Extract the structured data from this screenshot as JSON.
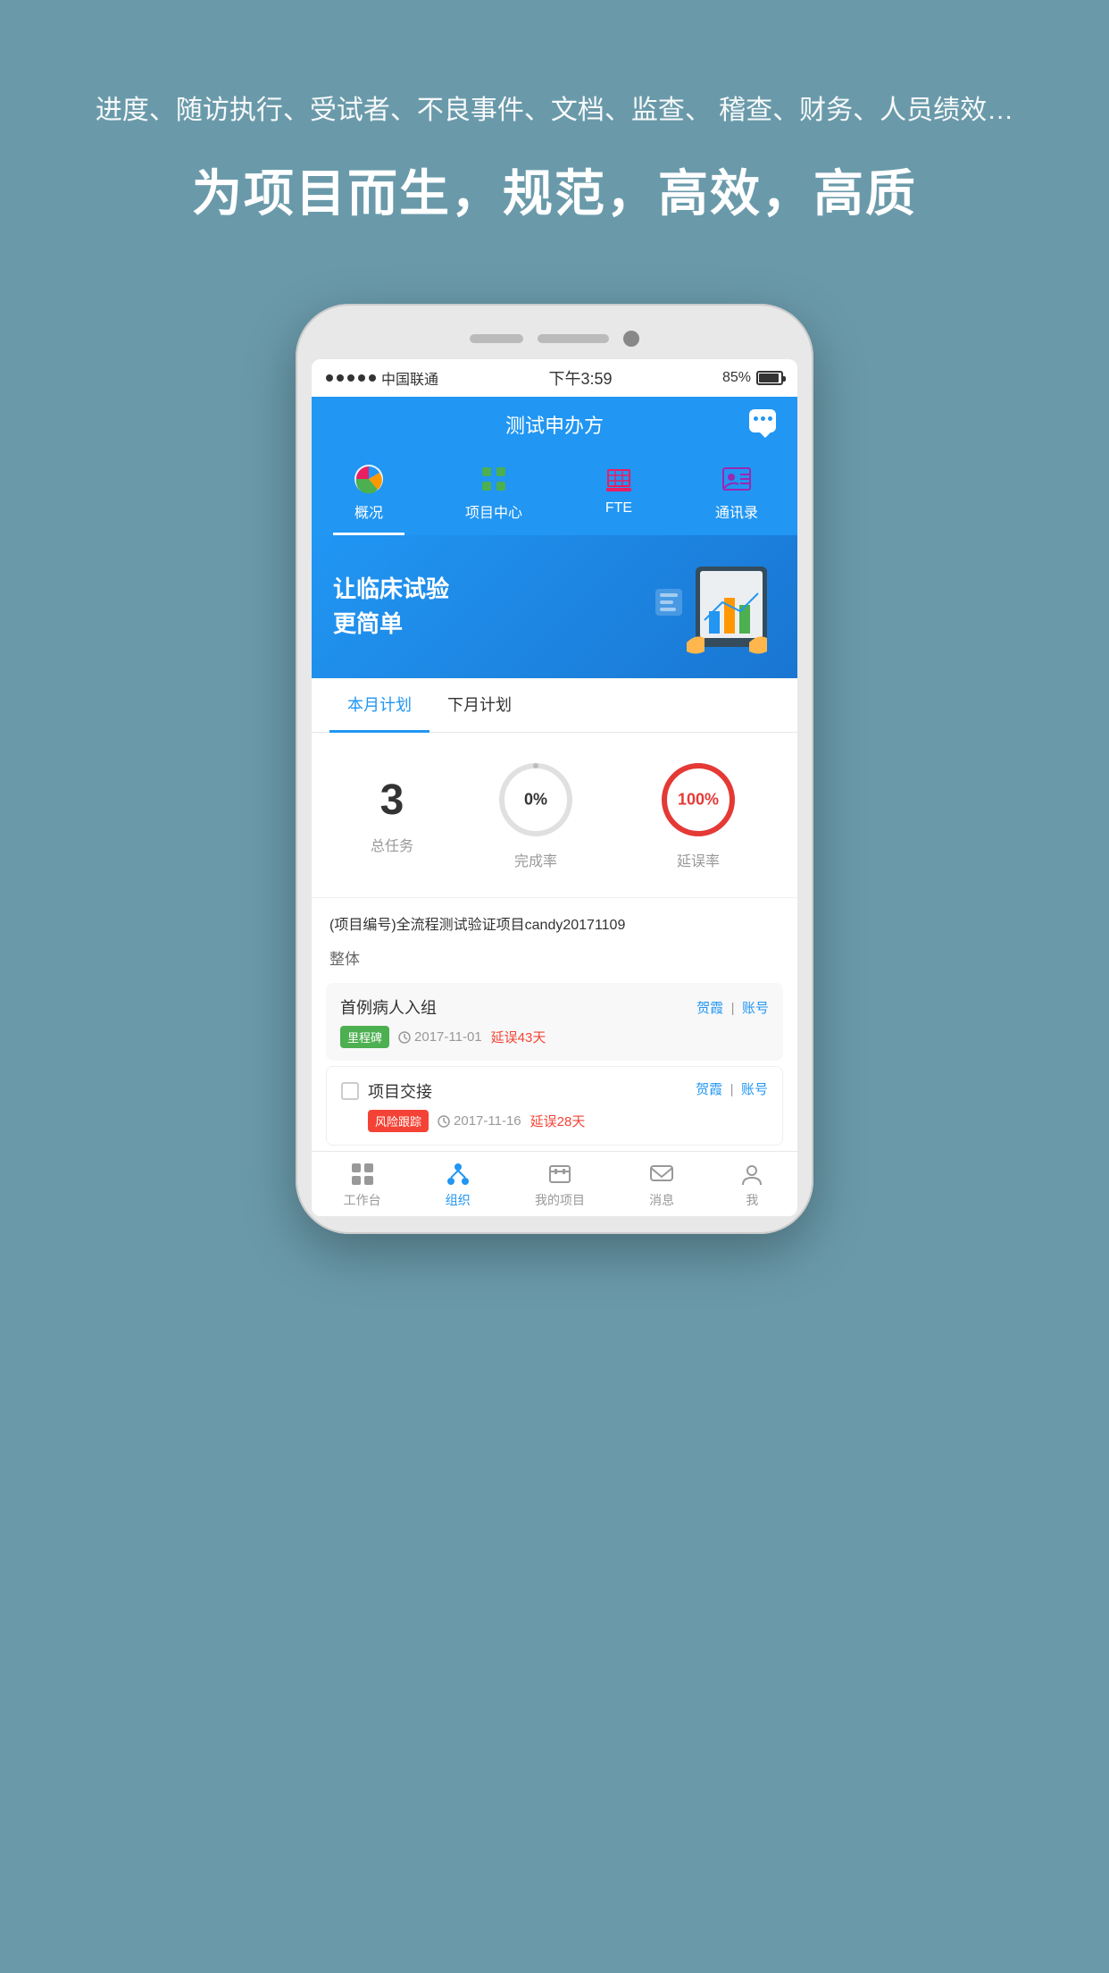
{
  "background": {
    "color": "#6a9aaa"
  },
  "top_section": {
    "subtitle": "进度、随访执行、受试者、不良事件、文档、监查、\n稽查、财务、人员绩效…",
    "title": "为项目而生，规范，高效，高质"
  },
  "phone": {
    "status_bar": {
      "dots": 5,
      "carrier": "中国联通",
      "time": "下午3:59",
      "battery_percent": "85%"
    },
    "app_header": {
      "title": "测试申办方"
    },
    "nav_tabs": [
      {
        "id": "overview",
        "label": "概况",
        "active": true
      },
      {
        "id": "projects",
        "label": "项目中心",
        "active": false
      },
      {
        "id": "fte",
        "label": "FTE",
        "active": false
      },
      {
        "id": "contacts",
        "label": "通讯录",
        "active": false
      }
    ],
    "banner": {
      "text": "让临床试验\n更简单"
    },
    "plan_section": {
      "tabs": [
        {
          "label": "本月计划",
          "active": true
        },
        {
          "label": "下月计划",
          "active": false
        }
      ],
      "stats": [
        {
          "value": "3",
          "label": "总任务",
          "type": "number"
        },
        {
          "value": "0%",
          "label": "完成率",
          "progress": 0,
          "type": "circle_gray"
        },
        {
          "value": "100%",
          "label": "延误率",
          "progress": 100,
          "type": "circle_red"
        }
      ],
      "project_name": "(项目编号)全流程测试验证项目candy20171109",
      "project_group": "整体",
      "tasks": [
        {
          "name": "首例病人入组",
          "badge": "里程碑",
          "badge_type": "milestone",
          "date": "2017-11-01",
          "delay": "延误43天",
          "assignee1": "贺霞",
          "assignee2": "账号",
          "has_checkbox": false
        },
        {
          "name": "项目交接",
          "badge": "风险跟踪",
          "badge_type": "risk",
          "date": "2017-11-16",
          "delay": "延误28天",
          "assignee1": "贺霞",
          "assignee2": "账号",
          "has_checkbox": true
        }
      ]
    },
    "bottom_nav": [
      {
        "id": "workbench",
        "label": "工作台",
        "active": false
      },
      {
        "id": "org",
        "label": "组织",
        "active": true
      },
      {
        "id": "my_projects",
        "label": "我的项目",
        "active": false
      },
      {
        "id": "messages",
        "label": "消息",
        "active": false
      },
      {
        "id": "me",
        "label": "我",
        "active": false
      }
    ]
  }
}
